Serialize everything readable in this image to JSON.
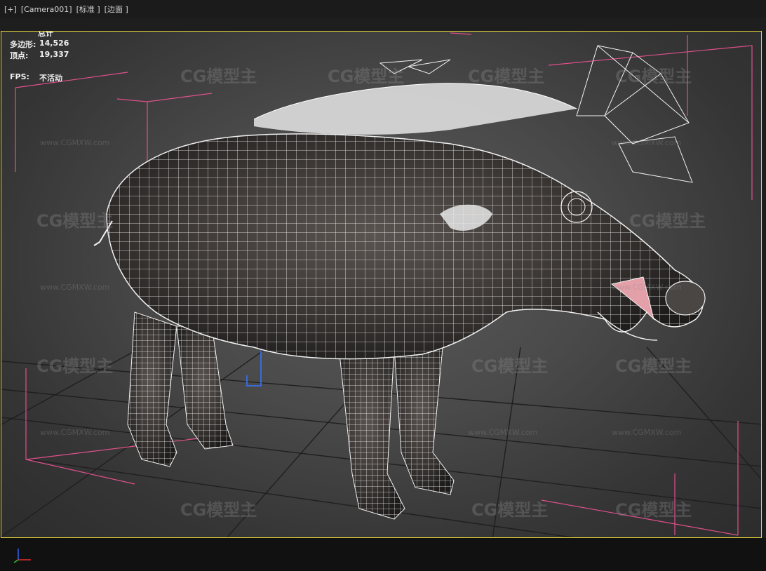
{
  "viewport_header": {
    "menu": "[+]",
    "camera": "[Camera001]",
    "shading": "[标准 ]",
    "display_mode": "[边面 ]"
  },
  "stats": {
    "total_label": "总计",
    "polygons_label": "多边形:",
    "polygons_value": "14,526",
    "vertices_label": "顶点:",
    "vertices_value": "19,337",
    "fps_label": "FPS:",
    "fps_value": "不活动"
  },
  "watermark": {
    "logo_text": "CG模型主",
    "url": "www.CGMXW.com"
  },
  "colors": {
    "viewport_border": "#e8d83a",
    "bounding_box": "#e0508a",
    "wireframe": "#f2f2f2",
    "grid": "#1f1f1f",
    "axis_x": "#e03030",
    "axis_y": "#30c030",
    "axis_z": "#3060e0"
  },
  "model": {
    "subject": "wild boar",
    "material": "dark fur texture with white wireframe overlay"
  }
}
